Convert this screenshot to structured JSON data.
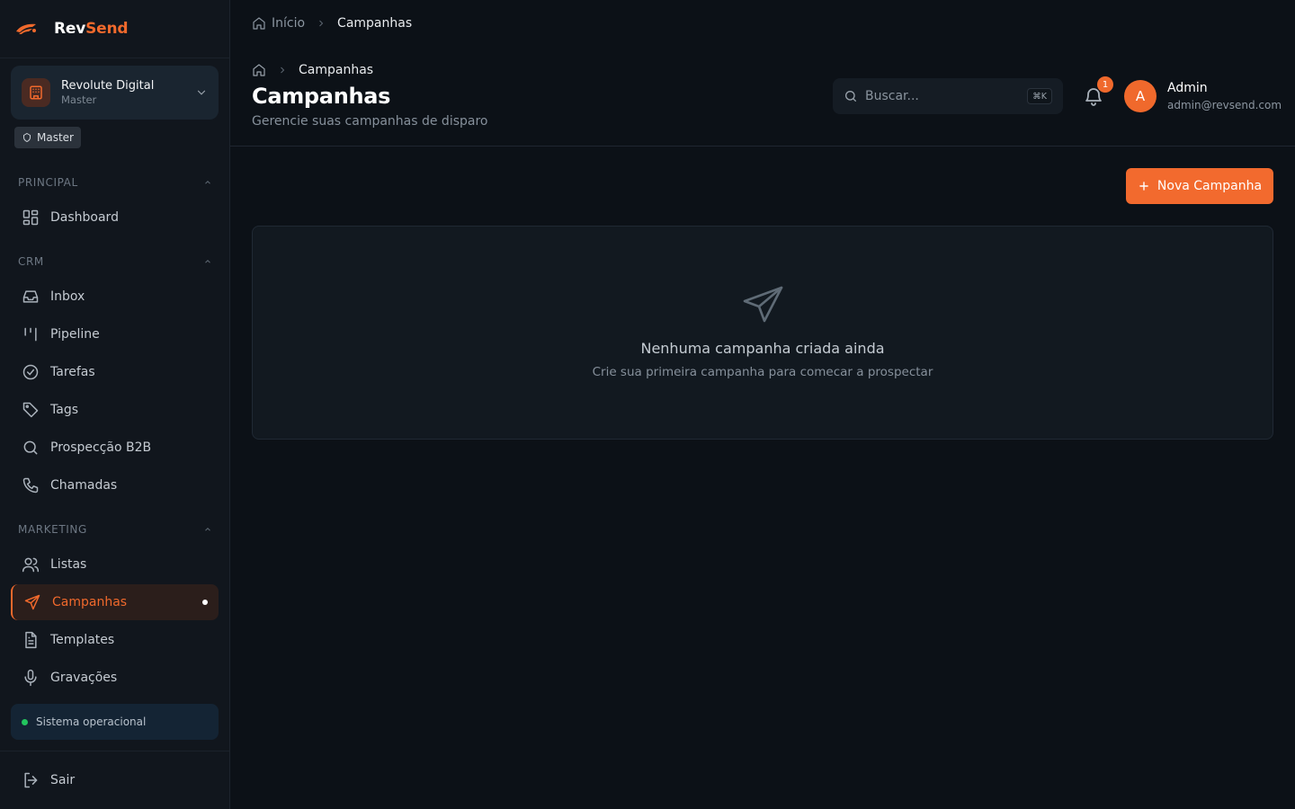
{
  "brand": {
    "name_part1": "Rev",
    "name_part2": "Send",
    "accent": "#f0692c"
  },
  "org": {
    "name": "Revolute Digital",
    "role": "Master"
  },
  "role_badge": "Master",
  "sidebar": {
    "sections": [
      {
        "label": "PRINCIPAL",
        "items": [
          {
            "label": "Dashboard",
            "icon": "dashboard-icon"
          }
        ]
      },
      {
        "label": "CRM",
        "items": [
          {
            "label": "Inbox",
            "icon": "inbox-icon"
          },
          {
            "label": "Pipeline",
            "icon": "pipeline-icon"
          },
          {
            "label": "Tarefas",
            "icon": "check-circle-icon"
          },
          {
            "label": "Tags",
            "icon": "tag-icon"
          },
          {
            "label": "Prospecção B2B",
            "icon": "search-icon"
          },
          {
            "label": "Chamadas",
            "icon": "phone-icon"
          }
        ]
      },
      {
        "label": "MARKETING",
        "items": [
          {
            "label": "Listas",
            "icon": "users-icon"
          },
          {
            "label": "Campanhas",
            "icon": "send-icon",
            "active": true
          },
          {
            "label": "Templates",
            "icon": "file-text-icon"
          },
          {
            "label": "Gravações",
            "icon": "mic-icon"
          }
        ]
      }
    ],
    "status": "Sistema operacional",
    "logout": "Sair"
  },
  "topbar": {
    "breadcrumb": [
      "Início",
      "Campanhas"
    ]
  },
  "header": {
    "breadcrumb_current": "Campanhas",
    "title": "Campanhas",
    "subtitle": "Gerencie suas campanhas de disparo",
    "search_placeholder": "Buscar...",
    "search_shortcut": "⌘K",
    "notifications_count": "1",
    "user": {
      "initial": "A",
      "name": "Admin",
      "email": "admin@revsend.com"
    }
  },
  "actions": {
    "new_campaign": "Nova Campanha"
  },
  "empty_state": {
    "title": "Nenhuma campanha criada ainda",
    "description": "Crie sua primeira campanha para comecar a prospectar"
  }
}
